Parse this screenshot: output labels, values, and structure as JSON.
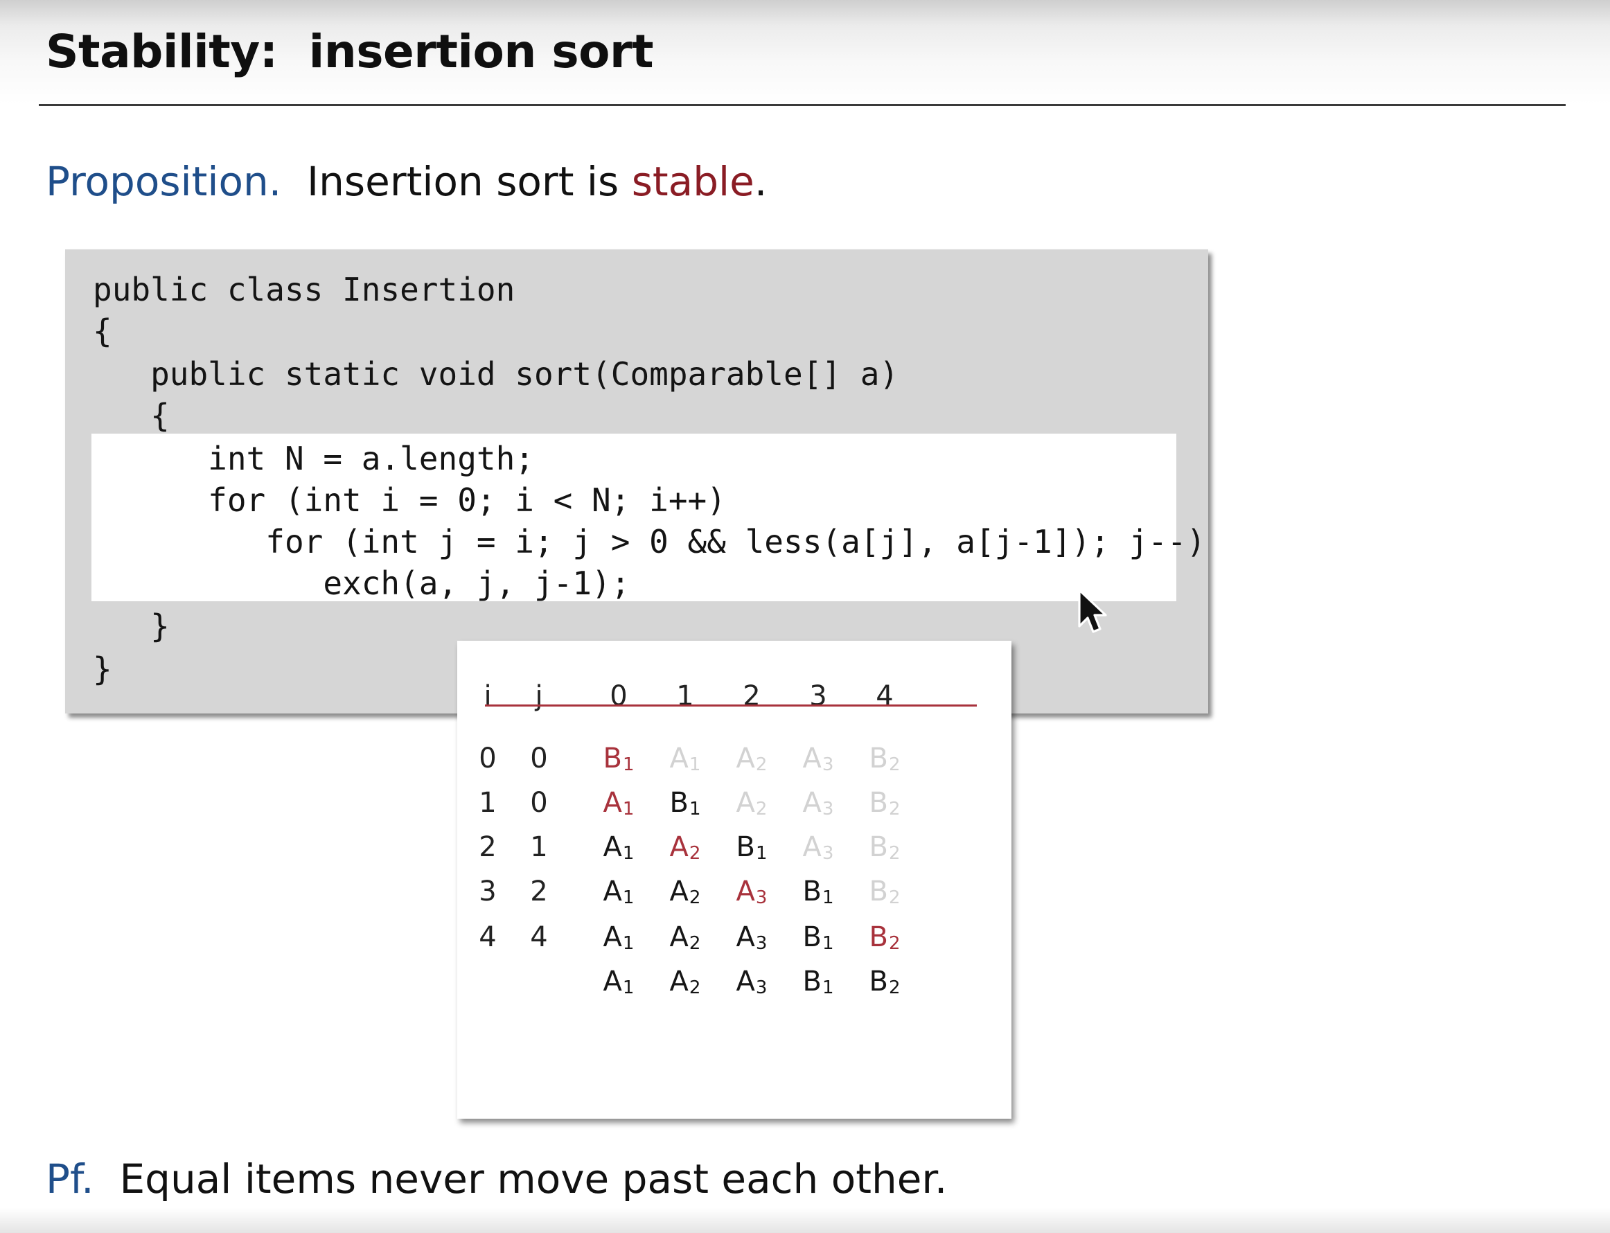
{
  "slide": {
    "title": "Stability:  insertion sort",
    "proposition_label": "Proposition.",
    "proposition_text_before": "  Insertion sort is ",
    "proposition_emph": "stable",
    "proposition_text_after": ".",
    "pf_label": "Pf.",
    "pf_text": "  Equal items never move past each other."
  },
  "code": {
    "lines": [
      "public class Insertion",
      "{",
      "   public static void sort(Comparable[] a)",
      "   {",
      "      int N = a.length;",
      "      for (int i = 0; i < N; i++)",
      "         for (int j = i; j > 0 && less(a[j], a[j-1]); j--)",
      "            exch(a, j, j-1);",
      "   }",
      "}"
    ]
  },
  "trace": {
    "headers": [
      "i",
      "j",
      "0",
      "1",
      "2",
      "3",
      "4"
    ],
    "rows": [
      {
        "i": "0",
        "j": "0",
        "cells": [
          {
            "letter": "B",
            "sub": "1",
            "style": "red"
          },
          {
            "letter": "A",
            "sub": "1",
            "style": "gray"
          },
          {
            "letter": "A",
            "sub": "2",
            "style": "gray"
          },
          {
            "letter": "A",
            "sub": "3",
            "style": "gray"
          },
          {
            "letter": "B",
            "sub": "2",
            "style": "gray"
          }
        ]
      },
      {
        "i": "1",
        "j": "0",
        "cells": [
          {
            "letter": "A",
            "sub": "1",
            "style": "red"
          },
          {
            "letter": "B",
            "sub": "1",
            "style": "black"
          },
          {
            "letter": "A",
            "sub": "2",
            "style": "gray"
          },
          {
            "letter": "A",
            "sub": "3",
            "style": "gray"
          },
          {
            "letter": "B",
            "sub": "2",
            "style": "gray"
          }
        ]
      },
      {
        "i": "2",
        "j": "1",
        "cells": [
          {
            "letter": "A",
            "sub": "1",
            "style": "black"
          },
          {
            "letter": "A",
            "sub": "2",
            "style": "red"
          },
          {
            "letter": "B",
            "sub": "1",
            "style": "black"
          },
          {
            "letter": "A",
            "sub": "3",
            "style": "gray"
          },
          {
            "letter": "B",
            "sub": "2",
            "style": "gray"
          }
        ]
      },
      {
        "i": "3",
        "j": "2",
        "cells": [
          {
            "letter": "A",
            "sub": "1",
            "style": "black"
          },
          {
            "letter": "A",
            "sub": "2",
            "style": "black"
          },
          {
            "letter": "A",
            "sub": "3",
            "style": "red"
          },
          {
            "letter": "B",
            "sub": "1",
            "style": "black"
          },
          {
            "letter": "B",
            "sub": "2",
            "style": "gray"
          }
        ]
      },
      {
        "i": "4",
        "j": "4",
        "cells": [
          {
            "letter": "A",
            "sub": "1",
            "style": "black"
          },
          {
            "letter": "A",
            "sub": "2",
            "style": "black"
          },
          {
            "letter": "A",
            "sub": "3",
            "style": "black"
          },
          {
            "letter": "B",
            "sub": "1",
            "style": "black"
          },
          {
            "letter": "B",
            "sub": "2",
            "style": "red"
          }
        ]
      },
      {
        "i": "",
        "j": "",
        "cells": [
          {
            "letter": "A",
            "sub": "1",
            "style": "black"
          },
          {
            "letter": "A",
            "sub": "2",
            "style": "black"
          },
          {
            "letter": "A",
            "sub": "3",
            "style": "black"
          },
          {
            "letter": "B",
            "sub": "1",
            "style": "black"
          },
          {
            "letter": "B",
            "sub": "2",
            "style": "black"
          }
        ]
      }
    ]
  },
  "colors": {
    "label_blue": "#1f4e8a",
    "emphasis_red": "#8a1c24",
    "trace_red": "#a8323c",
    "trace_gray": "#d2d2d2",
    "code_panel_bg": "#d6d6d6"
  },
  "icons": {
    "cursor": "mouse-pointer-arrow-icon"
  }
}
